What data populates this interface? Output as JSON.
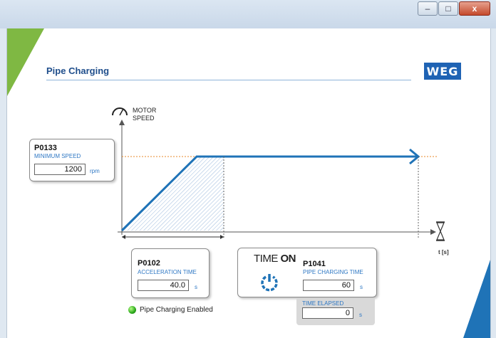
{
  "window": {
    "buttons": {
      "minimize": "–",
      "maximize": "□",
      "close": "x"
    }
  },
  "header": {
    "title": "Pipe Charging",
    "logo_text": "WEG"
  },
  "chart_labels": {
    "motor_speed": "MOTOR SPEED",
    "time_axis": "t [s]"
  },
  "params": {
    "p0133": {
      "code": "P0133",
      "name": "MINIMUM SPEED",
      "value": "1200",
      "unit": "rpm"
    },
    "p0102": {
      "code": "P0102",
      "name": "ACCELERATION TIME",
      "value": "40.0",
      "unit": "s"
    },
    "p1041": {
      "code": "P1041",
      "name": "PIPE CHARGING TIME",
      "value": "60",
      "unit": "s"
    },
    "elapsed": {
      "name": "TIME ELAPSED",
      "value": "0",
      "unit": "s"
    }
  },
  "time_on": {
    "prefix": "TIME",
    "suffix": "ON"
  },
  "status": {
    "text": "Pipe Charging Enabled",
    "led_color": "#2aa71a"
  },
  "colors": {
    "accent": "#1f73b7",
    "green": "#7fb843",
    "orange": "#e88a2a"
  }
}
